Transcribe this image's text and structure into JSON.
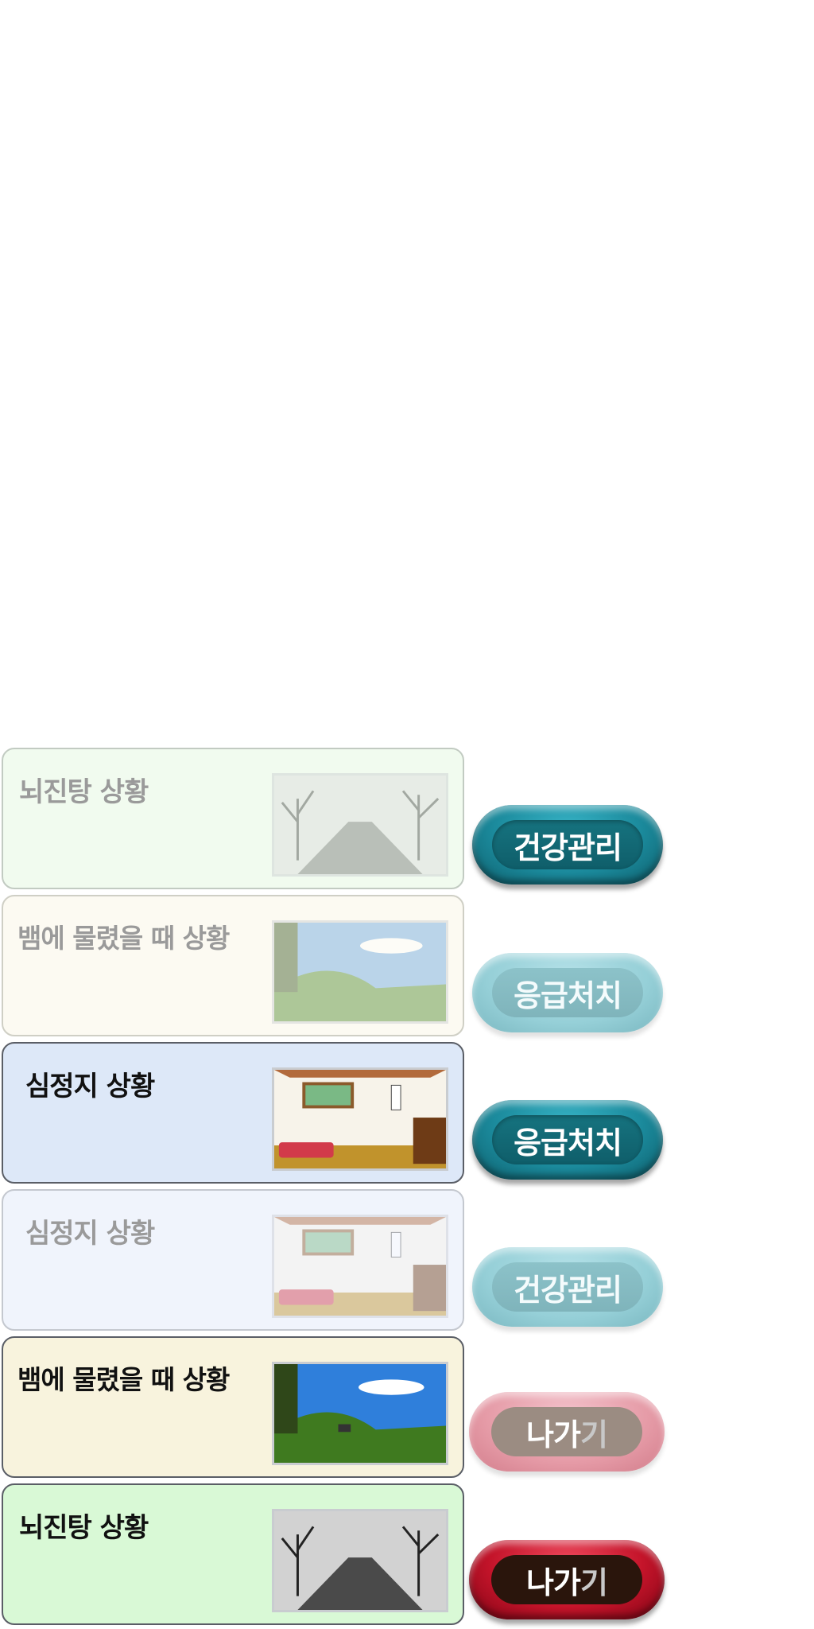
{
  "cards": [
    {
      "label": "뇌진탕 상황",
      "scene": "snowy-road",
      "state": "faded"
    },
    {
      "label": "뱀에 물렸을 때 상황",
      "scene": "grassy-hill",
      "state": "faded"
    },
    {
      "label": "심정지 상황",
      "scene": "room",
      "state": "active"
    },
    {
      "label": "심정지 상황",
      "scene": "room",
      "state": "faded"
    },
    {
      "label": "뱀에 물렸을 때 상황",
      "scene": "grassy-hill",
      "state": "active"
    },
    {
      "label": "뇌진탕 상황",
      "scene": "snowy-road",
      "state": "active"
    }
  ],
  "buttons": {
    "health_active": {
      "label": "건강관리"
    },
    "emergency_faded": {
      "label": "응급처치"
    },
    "emergency_active": {
      "label": "응급처치"
    },
    "health_faded": {
      "label": "건강관리"
    },
    "exit_faded": {
      "label_main": "나가",
      "label_end": "기"
    },
    "exit_active": {
      "label_main": "나가",
      "label_end": "기"
    }
  },
  "colors": {
    "card_bg_faded_green": "#f1fbef",
    "card_bg_faded_cream": "#fcfaf2",
    "card_bg_active_blue": "#dde8f8",
    "card_bg_faded_blue": "#f0f4fc",
    "card_bg_active_cream": "#f8f3dd",
    "card_bg_active_green": "#d9f9d6",
    "teal_button": "#1b8a9c",
    "red_button": "#c4142a"
  }
}
